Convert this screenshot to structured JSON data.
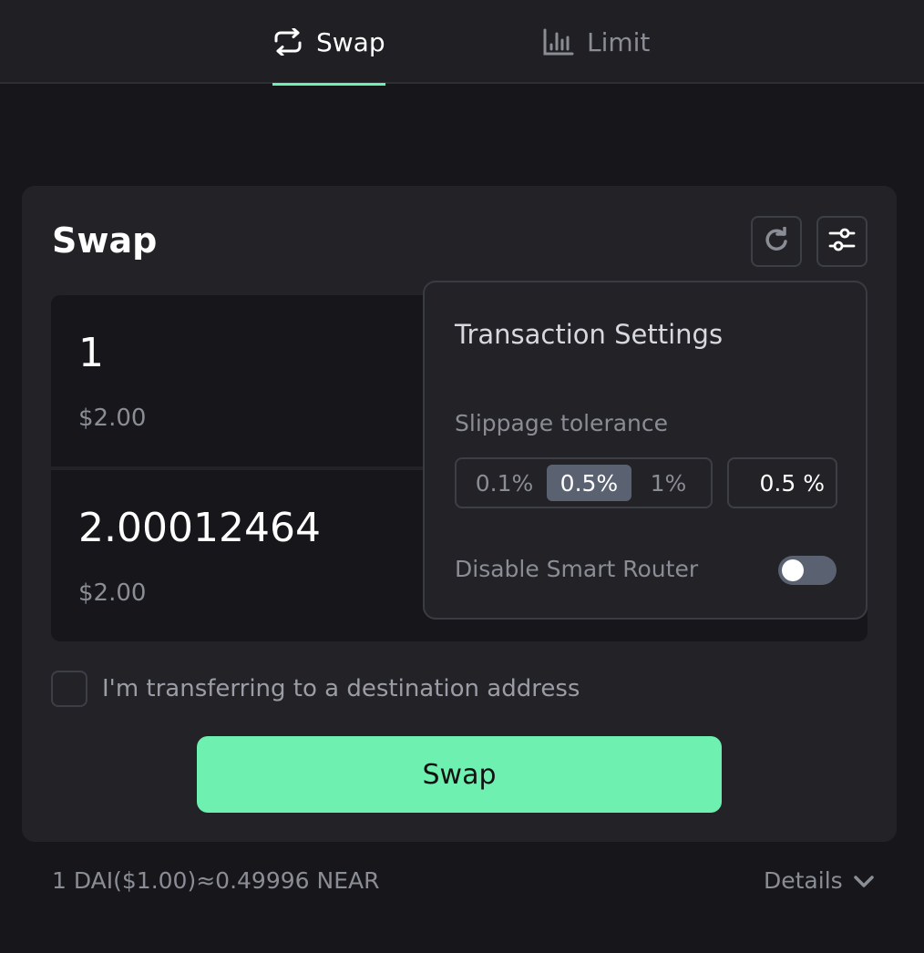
{
  "tabs": [
    {
      "label": "Swap",
      "icon": "swap-arrows-icon",
      "active": true
    },
    {
      "label": "Limit",
      "icon": "chart-bars-icon",
      "active": false
    }
  ],
  "card": {
    "title": "Swap",
    "refresh_icon": "refresh-icon",
    "settings_icon": "sliders-icon"
  },
  "from": {
    "amount": "1",
    "usd": "$2.00"
  },
  "to": {
    "amount": "2.00012464",
    "usd": "$2.00"
  },
  "settings": {
    "title": "Transaction Settings",
    "slippage_label": "Slippage tolerance",
    "options": [
      "0.1%",
      "0.5%",
      "1%"
    ],
    "selected_option": "0.5%",
    "custom_value": "0.5 %",
    "router_label": "Disable Smart Router",
    "router_enabled": false
  },
  "destination_label": "I'm transferring to a destination address",
  "swap_button": "Swap",
  "rate_text": "1 DAI($1.00)≈0.49996 NEAR",
  "details_label": "Details",
  "colors": {
    "accent": "#6ef0b0",
    "background": "#17171b",
    "card": "#222227",
    "selected_option": "#5a6170"
  }
}
